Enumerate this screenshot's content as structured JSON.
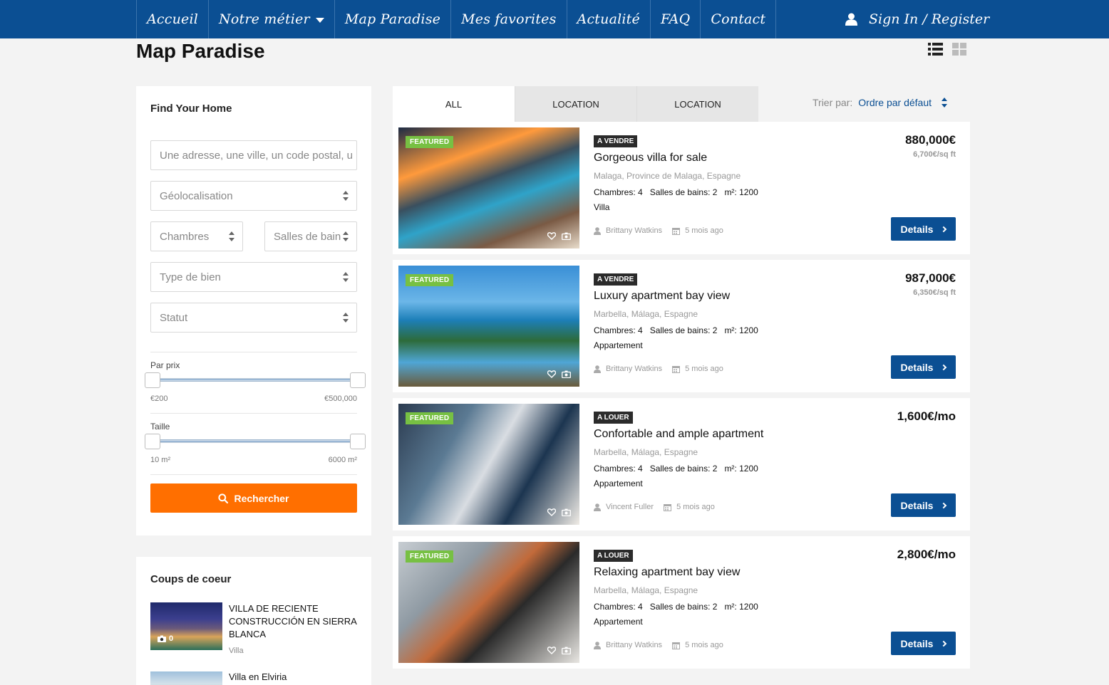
{
  "nav": {
    "items": [
      {
        "label": "Accueil"
      },
      {
        "label": "Notre métier"
      },
      {
        "label": "Map Paradise"
      },
      {
        "label": "Mes favorites"
      },
      {
        "label": "Actualité"
      },
      {
        "label": "FAQ"
      },
      {
        "label": "Contact"
      }
    ],
    "signin": "Sign In / Register"
  },
  "page": {
    "title": "Map Paradise"
  },
  "search": {
    "title": "Find Your Home",
    "address_placeholder": "Une adresse, une ville, un code postal, u",
    "geolocation": "Géolocalisation",
    "bedrooms": "Chambres",
    "bathrooms": "Salles de bain",
    "type": "Type de bien",
    "status": "Statut",
    "price_label": "Par prix",
    "price_min": "€200",
    "price_max": "€500,000",
    "size_label": "Taille",
    "size_min": "10 m²",
    "size_max": "6000 m²",
    "button": "Rechercher"
  },
  "favorites": {
    "title": "Coups de coeur",
    "items": [
      {
        "title": "VILLA DE RECIENTE CONSTRUCCIÓN EN SIERRA BLANCA",
        "type": "Villa",
        "photo_count": "0"
      },
      {
        "title": "Villa en Elviria"
      }
    ]
  },
  "tabs": [
    {
      "label": "ALL"
    },
    {
      "label": "LOCATION"
    },
    {
      "label": "LOCATION"
    }
  ],
  "sort": {
    "label": "Trier par:",
    "value": "Ordre par défaut"
  },
  "listings": [
    {
      "featured": "FEATURED",
      "status": "A VENDRE",
      "title": "Gorgeous villa for sale",
      "address": "Malaga, Province de Malaga, Espagne",
      "bedrooms": "Chambres: 4",
      "bathrooms": "Salles de bains: 2",
      "area": "m²: 1200",
      "type": "Villa",
      "agent": "Brittany Watkins",
      "date": "5 mois ago",
      "price": "880,000€",
      "sqft": "6,700€/sq ft",
      "button": "Details"
    },
    {
      "featured": "FEATURED",
      "status": "A VENDRE",
      "title": "Luxury apartment bay view",
      "address": "Marbella, Málaga, Espagne",
      "bedrooms": "Chambres: 4",
      "bathrooms": "Salles de bains: 2",
      "area": "m²: 1200",
      "type": "Appartement",
      "agent": "Brittany Watkins",
      "date": "5 mois ago",
      "price": "987,000€",
      "sqft": "6,350€/sq ft",
      "button": "Details"
    },
    {
      "featured": "FEATURED",
      "status": "A LOUER",
      "title": "Confortable and ample apartment",
      "address": "Marbella, Málaga, Espagne",
      "bedrooms": "Chambres: 4",
      "bathrooms": "Salles de bains: 2",
      "area": "m²: 1200",
      "type": "Appartement",
      "agent": "Vincent Fuller",
      "date": "5 mois ago",
      "price": "1,600€/mo",
      "sqft": "",
      "button": "Details"
    },
    {
      "featured": "FEATURED",
      "status": "A LOUER",
      "title": "Relaxing apartment bay view",
      "address": "Marbella, Málaga, Espagne",
      "bedrooms": "Chambres: 4",
      "bathrooms": "Salles de bains: 2",
      "area": "m²: 1200",
      "type": "Appartement",
      "agent": "Brittany Watkins",
      "date": "5 mois ago",
      "price": "2,800€/mo",
      "sqft": "",
      "button": "Details"
    }
  ],
  "colors": {
    "nav_bg": "#0b4f93",
    "accent_orange": "#ff6f00",
    "featured_green": "#77c043",
    "status_dark": "#2b2b2b"
  },
  "icons": [
    "user-icon",
    "list-view-icon",
    "grid-view-icon",
    "search-icon",
    "heart-icon",
    "camera-icon",
    "calendar-icon"
  ]
}
